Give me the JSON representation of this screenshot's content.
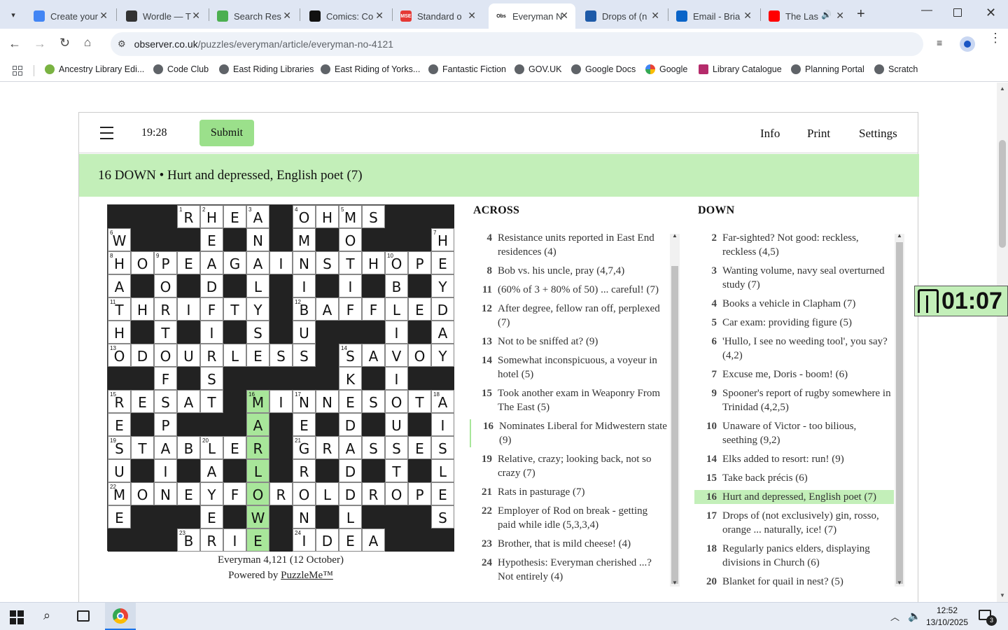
{
  "browser": {
    "tabs": [
      {
        "title": "Create your",
        "favicon_color": "#4285f4"
      },
      {
        "title": "Wordle — T",
        "favicon_color": "#333333"
      },
      {
        "title": "Search Res",
        "favicon_color": "#4caf50"
      },
      {
        "title": "Comics: Co",
        "favicon_color": "#111111"
      },
      {
        "title": "Standard o",
        "favicon_color": "#e53935",
        "favicon_text": "MSE"
      },
      {
        "title": "Everyman N",
        "favicon_color": "#ffffff",
        "favicon_text": "Obs",
        "active": true
      },
      {
        "title": "Drops of (n",
        "favicon_color": "#1e5aa8"
      },
      {
        "title": "Email - Bria",
        "favicon_color": "#0a64c8"
      },
      {
        "title": "The Las",
        "favicon_color": "#ff0000"
      }
    ],
    "url_domain": "observer.co.uk",
    "url_path": "/puzzles/everyman/article/everyman-no-4121",
    "bookmarks": [
      "Ancestry Library Edi...",
      "Code Club",
      "East Riding Libraries",
      "East Riding of Yorks...",
      "Fantastic Fiction",
      "GOV.UK",
      "Google Docs",
      "Google",
      "Library Catalogue",
      "Planning Portal",
      "Scratch"
    ]
  },
  "puzzle": {
    "timer": "19:28",
    "submit_label": "Submit",
    "menu": [
      "Info",
      "Print",
      "Settings"
    ],
    "current_clue": "16 DOWN • Hurt and depressed, English poet (7)",
    "caption": "Everyman 4,121 (12 October)",
    "powered_prefix": "Powered by ",
    "powered_link": "PuzzleMe™",
    "overlay_timer": "01:07",
    "grid_rows": [
      "###RHEA#OHMS####",
      "W###E#N#M#O###H",
      "HOPEAGAINSTHOPE",
      "A#O#D#L#I#I#B#Y",
      "THRIFTY#BAFFLED",
      "H#T#I#S#U#####I#A",
      "ODOURLESS#SAVOY",
      "##F#S####K#I###",
      "RESAT#MINNESOTA",
      "E#P###A#E#D#U#I",
      "STABLER#GRASSES",
      "U#I#A#L#R#D#T#L",
      "MONEYFOROLDROPE",
      "E###E#W#N#L###S",
      "###BRIE#IDEA###"
    ],
    "grid": [
      "###RHEA#OHMS###",
      "W###E#N#M#O###H",
      "HOPEAGAINSTHOPE",
      "A#O#D#L#I#I#B#Y",
      "THRIFTY#BAFFLED",
      "H#T#I#S#U###I#A",
      "ODOURLESS#SAVOY",
      "##F#S#####K#I##",
      "RESAT#MINNESOTA",
      "E#P###A#E#D#U#I",
      "STABLER#GRASSES",
      "U#I#A#L#R#D#T#L",
      "MONEYFOROLDROPE",
      "E###E#W#N#L###S",
      "###BRIE#IDEA###"
    ],
    "numbers": [
      {
        "r": 0,
        "c": 3,
        "n": "1"
      },
      {
        "r": 0,
        "c": 4,
        "n": "2"
      },
      {
        "r": 0,
        "c": 6,
        "n": "3"
      },
      {
        "r": 0,
        "c": 8,
        "n": "4"
      },
      {
        "r": 0,
        "c": 10,
        "n": "5"
      },
      {
        "r": 1,
        "c": 0,
        "n": "6"
      },
      {
        "r": 1,
        "c": 14,
        "n": "7"
      },
      {
        "r": 2,
        "c": 0,
        "n": "8"
      },
      {
        "r": 2,
        "c": 2,
        "n": "9"
      },
      {
        "r": 2,
        "c": 12,
        "n": "10"
      },
      {
        "r": 4,
        "c": 0,
        "n": "11"
      },
      {
        "r": 4,
        "c": 8,
        "n": "12"
      },
      {
        "r": 6,
        "c": 0,
        "n": "13"
      },
      {
        "r": 6,
        "c": 10,
        "n": "14"
      },
      {
        "r": 8,
        "c": 0,
        "n": "15"
      },
      {
        "r": 8,
        "c": 6,
        "n": "16"
      },
      {
        "r": 8,
        "c": 8,
        "n": "17"
      },
      {
        "r": 8,
        "c": 14,
        "n": "18"
      },
      {
        "r": 10,
        "c": 0,
        "n": "19"
      },
      {
        "r": 10,
        "c": 4,
        "n": "20"
      },
      {
        "r": 10,
        "c": 8,
        "n": "21"
      },
      {
        "r": 12,
        "c": 0,
        "n": "22"
      },
      {
        "r": 14,
        "c": 3,
        "n": "23"
      },
      {
        "r": 14,
        "c": 8,
        "n": "24"
      }
    ],
    "highlight": {
      "col": 6,
      "row_from": 8,
      "row_to": 14
    },
    "across_head": "ACROSS",
    "down_head": "DOWN",
    "across": [
      {
        "n": "4",
        "t": "Resistance units reported in East End residences (4)"
      },
      {
        "n": "8",
        "t": "Bob vs. his uncle, pray (4,7,4)"
      },
      {
        "n": "11",
        "t": "(60% of 3 + 80% of 50) ... careful! (7)"
      },
      {
        "n": "12",
        "t": "After degree, fellow ran off, perplexed (7)"
      },
      {
        "n": "13",
        "t": "Not to be sniffed at? (9)"
      },
      {
        "n": "14",
        "t": "Somewhat inconspicuous, a voyeur in hotel (5)"
      },
      {
        "n": "15",
        "t": "Took another exam in Weaponry From The East (5)"
      },
      {
        "n": "16",
        "t": "Nominates Liberal for Midwestern state (9)",
        "partial": true
      },
      {
        "n": "19",
        "t": "Relative, crazy; looking back, not so crazy (7)"
      },
      {
        "n": "21",
        "t": "Rats in pasturage (7)"
      },
      {
        "n": "22",
        "t": "Employer of Rod on break - getting paid while idle (5,3,3,4)"
      },
      {
        "n": "23",
        "t": "Brother, that is mild cheese! (4)"
      },
      {
        "n": "24",
        "t": "Hypothesis: Everyman cherished ...? Not entirely (4)"
      }
    ],
    "down": [
      {
        "n": "2",
        "t": "Far-sighted? Not good: reckless, reckless (4,5)"
      },
      {
        "n": "3",
        "t": "Wanting volume, navy seal overturned study (7)"
      },
      {
        "n": "4",
        "t": "Books a vehicle in Clapham (7)"
      },
      {
        "n": "5",
        "t": "Car exam: providing figure (5)"
      },
      {
        "n": "6",
        "t": "'Hullo, I see no weeding tool', you say? (4,2)"
      },
      {
        "n": "7",
        "t": "Excuse me, Doris - boom! (6)"
      },
      {
        "n": "9",
        "t": "Spooner's report of rugby somewhere in Trinidad (4,2,5)"
      },
      {
        "n": "10",
        "t": "Unaware of Victor - too bilious, seething (9,2)"
      },
      {
        "n": "14",
        "t": "Elks added to resort: run! (9)"
      },
      {
        "n": "15",
        "t": "Take back précis (6)"
      },
      {
        "n": "16",
        "t": "Hurt and depressed, English poet (7)",
        "selected": true
      },
      {
        "n": "17",
        "t": "Drops of (not exclusively) gin, rosso, orange ... naturally, ice! (7)"
      },
      {
        "n": "18",
        "t": "Regularly panics elders, displaying divisions in Church (6)"
      },
      {
        "n": "20",
        "t": "Blanket for quail in nest? (5)"
      }
    ]
  },
  "taskbar": {
    "time": "12:52",
    "date": "13/10/2025",
    "notification_count": "3"
  }
}
